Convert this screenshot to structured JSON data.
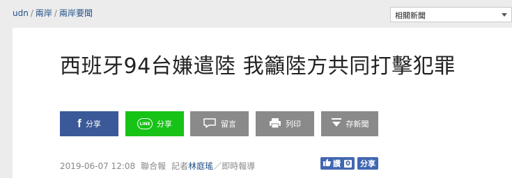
{
  "breadcrumb": {
    "items": [
      "udn",
      "兩岸",
      "兩岸要聞"
    ],
    "separator": "/"
  },
  "related_select": {
    "value": "相關新聞"
  },
  "article": {
    "title": "西班牙94台嫌遣陸 我籲陸方共同打擊犯罪",
    "datetime": "2019-06-07 12:08",
    "source": "聯合報",
    "reporter_prefix": "記者",
    "reporter": "林庭瑤",
    "reporter_suffix": "／即時報導"
  },
  "share_buttons": {
    "facebook": "分享",
    "line": "分享",
    "line_badge": "LINE",
    "comment": "留言",
    "print": "列印",
    "save": "存新聞"
  },
  "fb_social": {
    "like_label": "讚",
    "like_count": "0",
    "share_label": "分享"
  },
  "colors": {
    "facebook": "#3b5998",
    "line": "#16c316",
    "gray_button": "#8a8a8a",
    "link": "#1f4f86"
  }
}
